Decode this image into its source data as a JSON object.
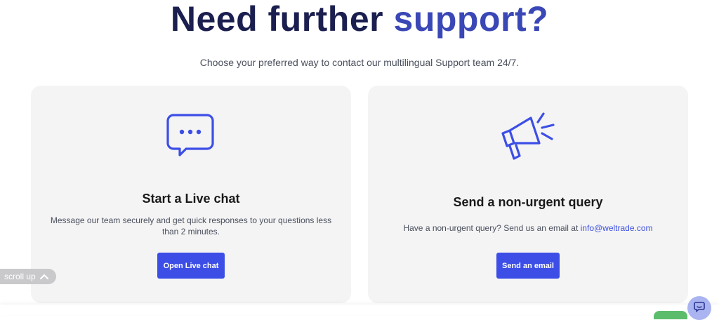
{
  "header": {
    "title_part1": "Need further",
    "title_part2": "support?",
    "subtitle": "Choose your preferred way to contact our multilingual Support team 24/7."
  },
  "cards": [
    {
      "icon": "chat-bubble-icon",
      "title": "Start a Live chat",
      "description": "Message our team securely and get quick responses to your questions less than 2 minutes.",
      "button_label": "Open Live chat"
    },
    {
      "icon": "megaphone-icon",
      "title": "Send a non-urgent query",
      "description_prefix": "Have a non-urgent query? Send us an email at",
      "email": "info@weltrade.com",
      "button_label": "Send an email"
    }
  ],
  "scroll_up": {
    "label": "scroll up",
    "icon": "chevron-up-icon"
  },
  "widgets": {
    "chat_widget_icon": "chat-widget-icon"
  },
  "colors": {
    "title_dark": "#1b1f4f",
    "title_accent": "#3a47b6",
    "accent": "#3c4ee6",
    "card_bg": "#f4f4f5"
  }
}
